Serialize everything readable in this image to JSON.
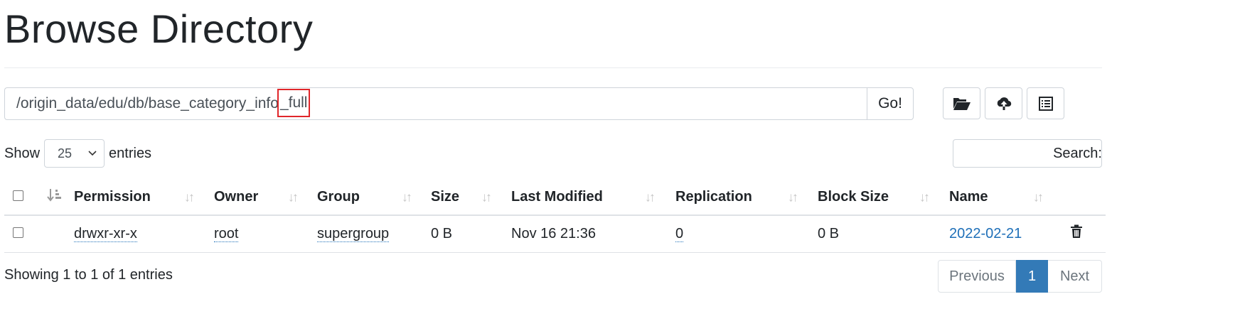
{
  "header": {
    "title": "Browse Directory"
  },
  "path_bar": {
    "path_prefix": "/origin_data/edu/db/base_category_info",
    "path_highlight": "_full",
    "go_label": "Go!"
  },
  "toolbar": {
    "icons": [
      "folder-open-icon",
      "cloud-upload-icon",
      "list-icon"
    ]
  },
  "table_controls": {
    "show_label": "Show",
    "entries_value": "25",
    "entries_label": "entries",
    "search_label": "Search:"
  },
  "table": {
    "columns": [
      "Permission",
      "Owner",
      "Group",
      "Size",
      "Last Modified",
      "Replication",
      "Block Size",
      "Name"
    ],
    "rows": [
      {
        "permission": "drwxr-xr-x",
        "owner": "root",
        "group": "supergroup",
        "size": "0 B",
        "last_modified": "Nov 16 21:36",
        "replication": "0",
        "block_size": "0 B",
        "name": "2022-02-21"
      }
    ]
  },
  "footer": {
    "showing": "Showing 1 to 1 of 1 entries",
    "prev": "Previous",
    "current_page": "1",
    "next": "Next"
  },
  "colors": {
    "link": "#1e6fb8",
    "active_page": "#337ab7",
    "highlight_box": "#e0262a"
  }
}
